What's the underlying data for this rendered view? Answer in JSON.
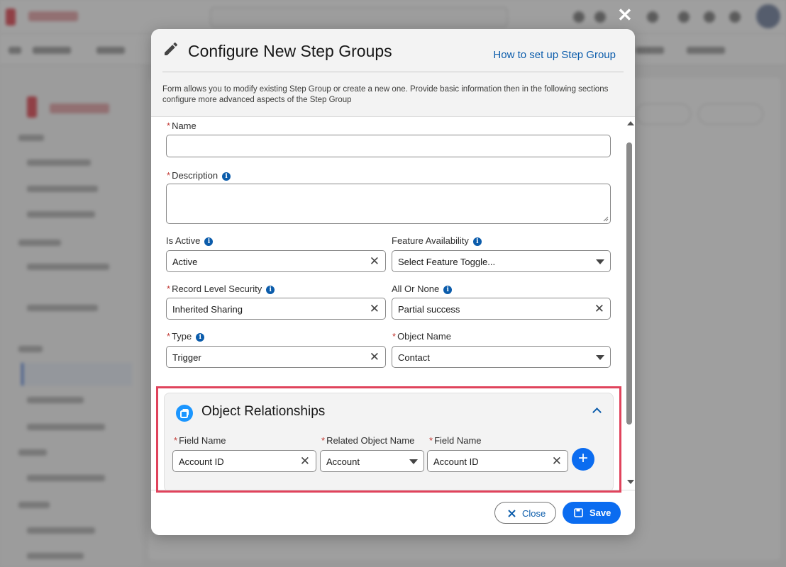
{
  "modal": {
    "title": "Configure New Step Groups",
    "help_link": "How to set up Step Group",
    "description": "Form allows you to modify existing Step Group or create a new one. Provide basic information then in the following sections configure more advanced aspects of the Step Group"
  },
  "form": {
    "name": {
      "label": "Name",
      "required": true,
      "value": ""
    },
    "description": {
      "label": "Description",
      "required": true,
      "value": ""
    },
    "is_active": {
      "label": "Is Active",
      "value": "Active"
    },
    "feature_availability": {
      "label": "Feature Availability",
      "value": "Select Feature Toggle..."
    },
    "record_level_security": {
      "label": "Record Level Security",
      "required": true,
      "value": "Inherited Sharing"
    },
    "all_or_none": {
      "label": "All Or None",
      "value": "Partial success"
    },
    "type": {
      "label": "Type",
      "required": true,
      "value": "Trigger"
    },
    "object_name": {
      "label": "Object Name",
      "required": true,
      "value": "Contact"
    }
  },
  "relationships": {
    "title": "Object Relationships",
    "field_name_label": "Field Name",
    "field_name_value": "Account ID",
    "related_object_label": "Related Object Name",
    "related_object_value": "Account",
    "related_field_label": "Field Name",
    "related_field_value": "Account ID"
  },
  "footer": {
    "close_label": "Close",
    "save_label": "Save"
  },
  "icons": {
    "close": "close-icon",
    "pencil": "pencil-icon",
    "info": "info-icon",
    "clear": "clear-icon",
    "caret": "chevron-down-icon",
    "add": "plus-icon",
    "save": "floppy-icon"
  },
  "colors": {
    "accent": "#0b6cf0",
    "link": "#0b5cab",
    "required": "#c23934",
    "highlight": "#e0435c"
  }
}
